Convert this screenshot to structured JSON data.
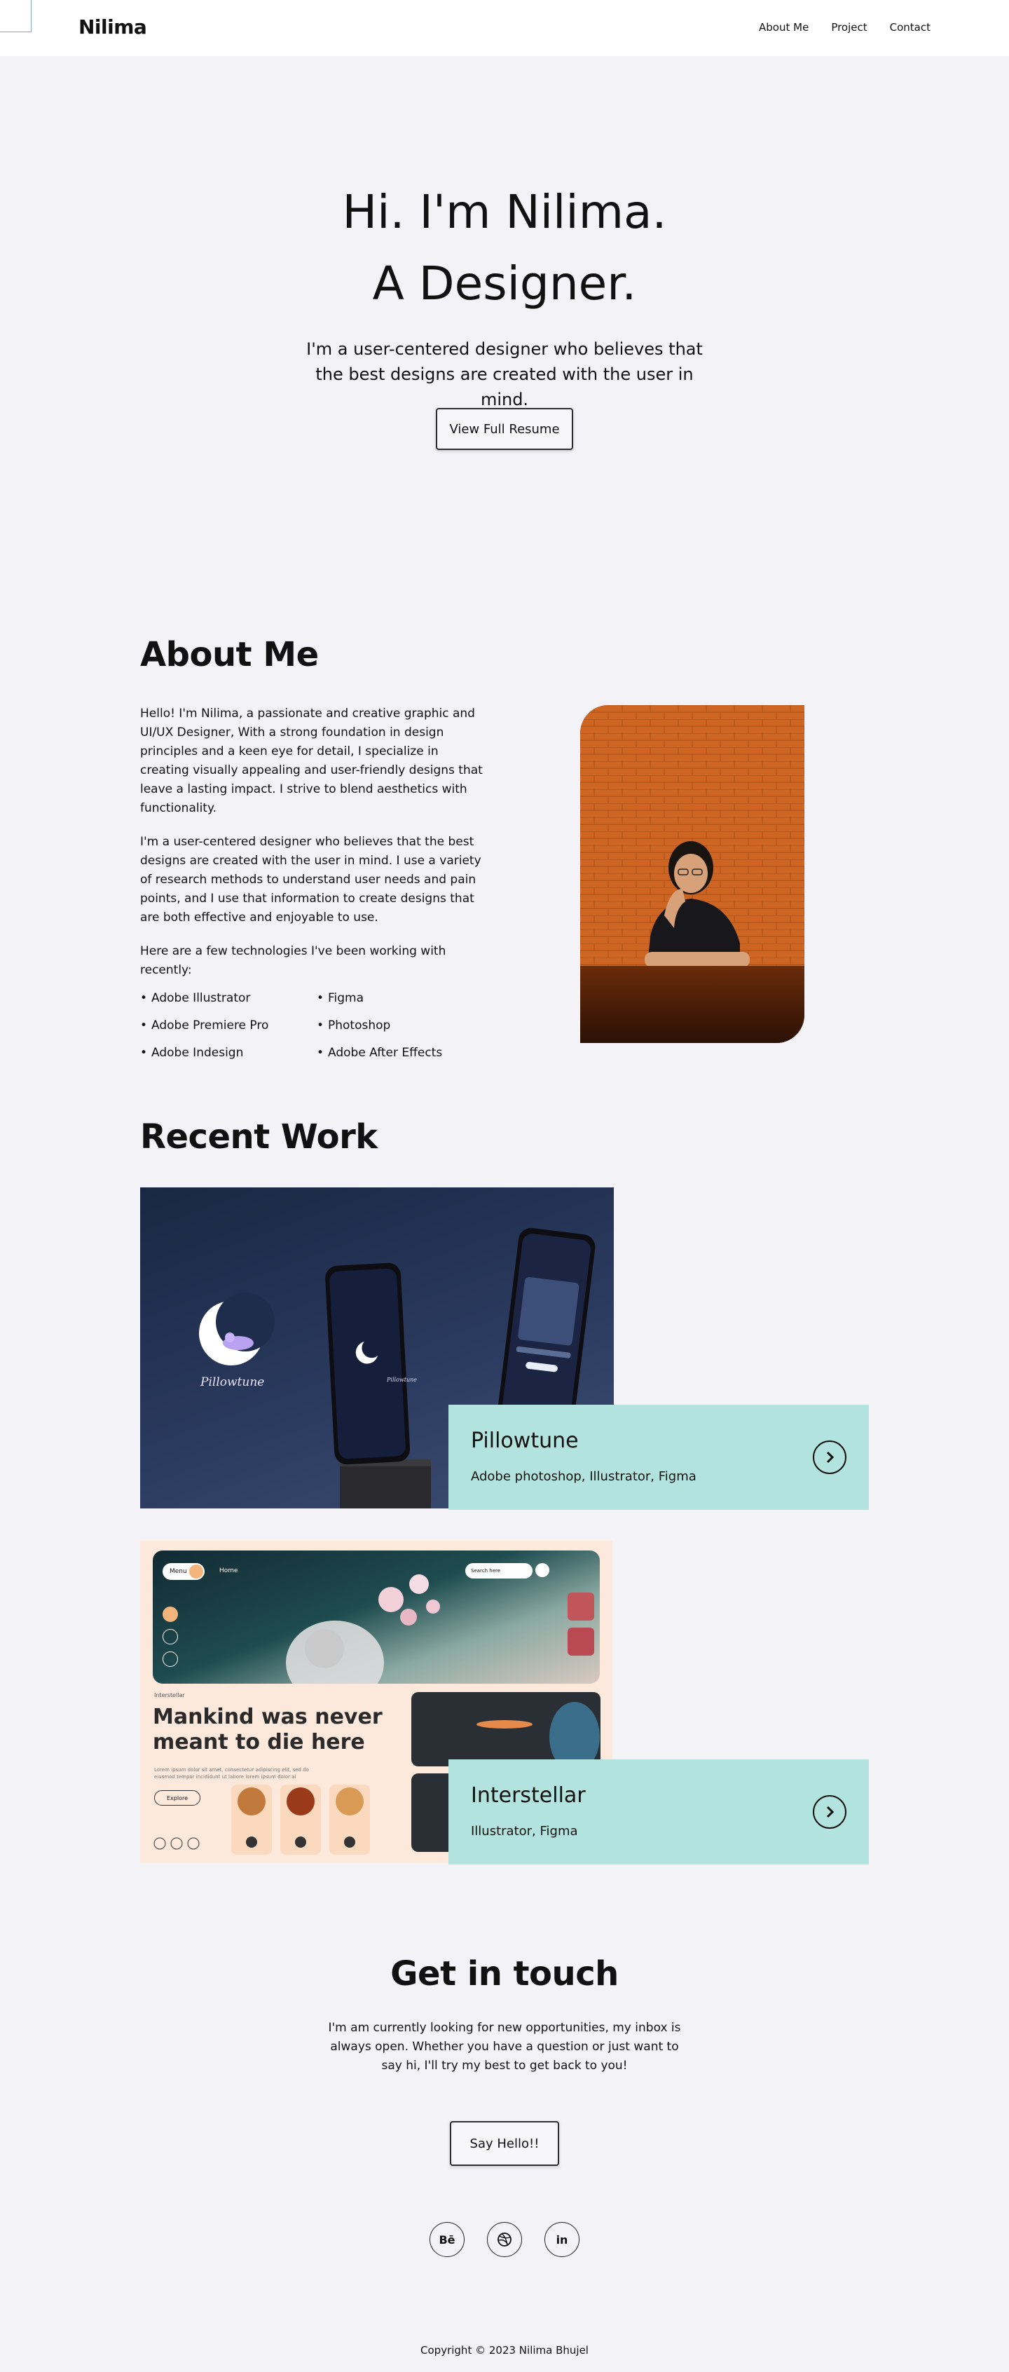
{
  "header": {
    "logo": "Nilima",
    "nav": [
      "About Me",
      "Project",
      "Contact"
    ]
  },
  "hero": {
    "line1": "Hi. I'm Nilima.",
    "line2": "A Designer.",
    "subtitle": "I'm a user-centered designer who believes that the best designs are created with the user in mind.",
    "resume_button": "View Full Resume"
  },
  "about": {
    "title": "About Me",
    "paragraphs": [
      "Hello! I'm Nilima, a passionate and creative graphic and UI/UX Designer, With a strong foundation in design principles and a keen eye for detail, I specialize in creating visually appealing and user-friendly designs that leave a lasting impact. I strive to blend aesthetics with functionality.",
      "I'm a user-centered designer who believes that the best designs are created with the user in mind. I use a variety of research methods to understand user needs and pain points, and I use that information to create designs that are both effective and enjoyable to use.",
      "Here are a few technologies I've been working with recently:"
    ],
    "technologies": [
      "Adobe Illustrator",
      "Figma",
      "Adobe Premiere Pro",
      "Photoshop",
      "Adobe Indesign",
      "Adobe After Effects"
    ]
  },
  "work": {
    "title": "Recent Work",
    "projects": [
      {
        "title": "Pillowtune",
        "tools": "Adobe photoshop, Illustrator, Figma",
        "image_caption": "Pillowtune",
        "phone_caption": "Pillowtune"
      },
      {
        "title": "Interstellar",
        "tools": "Illustrator, Figma",
        "mock_headline": "Mankind was never meant to die here",
        "mock_menu": "Menu",
        "mock_home": "Home",
        "mock_search": "Search here",
        "mock_small": "Interstellar",
        "mock_explore": "Explore",
        "mock_body": "Lorem ipsum dolor sit amet, consectetur adipiscing elit, sed do eiusmod tempor incididunt ut labore lorem ipsum dolor al"
      }
    ]
  },
  "contact": {
    "title": "Get in touch",
    "text": "I'm am currently looking for new opportunities, my inbox is always open. Whether you have a question or just want to say hi, I'll try my best to get back to you!",
    "button": "Say Hello!!",
    "social": [
      {
        "label": "Bē",
        "icon": "behance-icon"
      },
      {
        "label": "",
        "icon": "dribbble-icon"
      },
      {
        "label": "in",
        "icon": "linkedin-icon"
      }
    ]
  },
  "footer": {
    "copyright": "Copyright © 2023 Nilima Bhujel"
  }
}
